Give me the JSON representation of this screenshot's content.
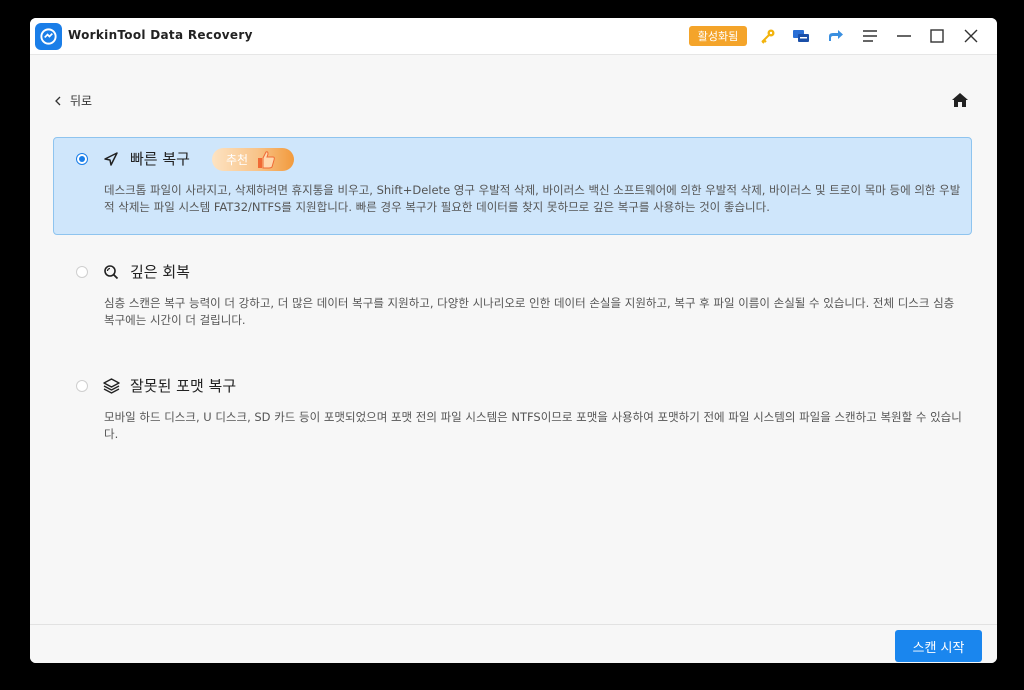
{
  "titlebar": {
    "app_title": "WorkinTool Data Recovery",
    "activate_label": "활성화됨",
    "icons": [
      "key-icon",
      "chat-icon",
      "share-icon",
      "menu-icon",
      "minimize-icon",
      "maximize-icon",
      "close-icon"
    ]
  },
  "nav": {
    "back_label": "뒤로",
    "home_icon": "home-icon"
  },
  "options": [
    {
      "title": "빠른 복구",
      "badge": "추천",
      "selected": true,
      "icon": "navigation-arrow-icon",
      "description": "데스크톱 파일이 사라지고, 삭제하려면 휴지통을 비우고, Shift+Delete 영구 우발적 삭제, 바이러스 백신 소프트웨어에 의한 우발적 삭제, 바이러스 및 트로이 목마 등에 의한 우발적 삭제는 파일 시스템 FAT32/NTFS를 지원합니다. 빠른 경우 복구가 필요한 데이터를 찾지 못하므로 깊은 복구를 사용하는 것이 좋습니다."
    },
    {
      "title": "깊은 회복",
      "selected": false,
      "icon": "deep-search-icon",
      "description": "심층 스캔은 복구 능력이 더 강하고, 더 많은 데이터 복구를 지원하고, 다양한 시나리오로 인한 데이터 손실을 지원하고, 복구 후 파일 이름이 손실될 수 있습니다. 전체 디스크 심층 복구에는 시간이 더 걸립니다."
    },
    {
      "title": "잘못된 포맷 복구",
      "selected": false,
      "icon": "layers-icon",
      "description": "모바일 하드 디스크, U 디스크, SD 카드 등이 포맷되었으며 포맷 전의 파일 시스템은 NTFS이므로 포맷을 사용하여 포맷하기 전에 파일 시스템의 파일을 스캔하고 복원할 수 있습니다."
    }
  ],
  "footer": {
    "scan_label": "스캔 시작"
  },
  "colors": {
    "accent": "#1a86ee",
    "activate": "#f4a42a",
    "selected_bg": "#cfe6fb"
  }
}
